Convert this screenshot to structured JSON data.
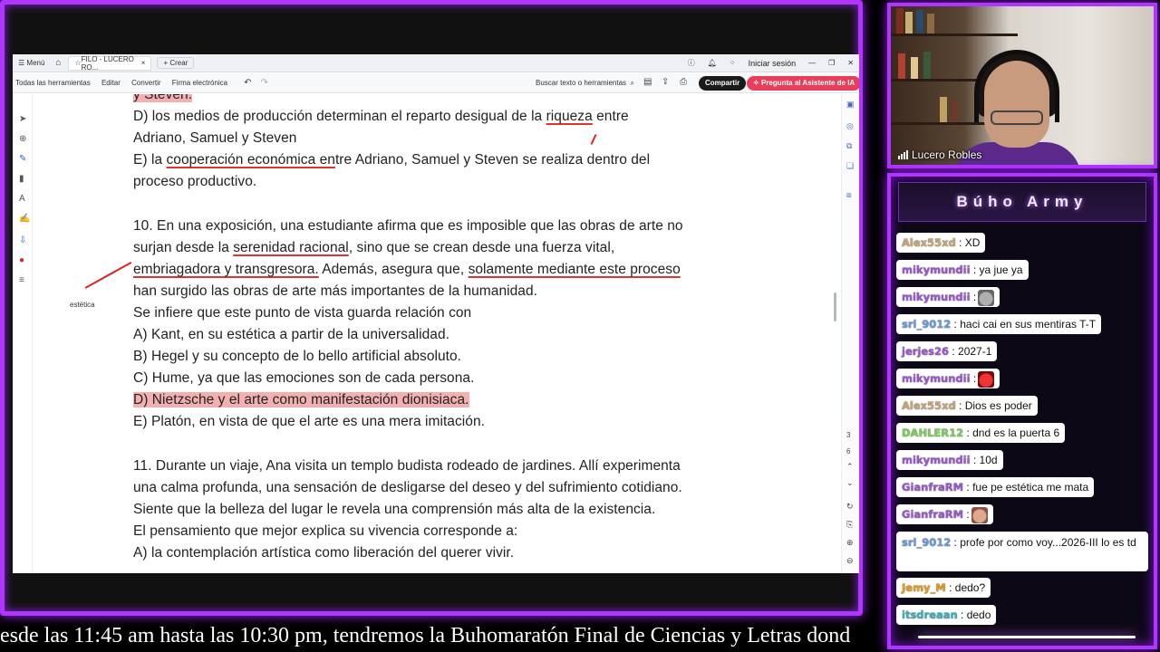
{
  "app": {
    "tabbar": {
      "menu_label": "Menú",
      "tab_title": "FILO - LUCERO RO...",
      "new_tab_label": "+ Crear",
      "sign_in": "Iniciar sesión"
    },
    "toolbar": {
      "items": [
        "Todas las herramientas",
        "Editar",
        "Convertir",
        "Firma electrónica"
      ],
      "search_placeholder": "Buscar texto o herramientas",
      "share_label": "Compartir",
      "ai_label": "Pregunta al Asistente de IA"
    }
  },
  "document": {
    "lines": [
      {
        "text": "y Steven."
      },
      {
        "text": "D) los medios de producción determinan el reparto desigual de la riqueza entre"
      },
      {
        "text": "Adriano, Samuel y Steven"
      },
      {
        "text": "E) la cooperación económica entre Adriano, Samuel y Steven se realiza dentro del"
      },
      {
        "text": "proceso productivo."
      },
      {
        "text": "10. En una exposición, una estudiante afirma que es imposible que las obras de arte no"
      },
      {
        "text": "surjan desde la serenidad racional, sino que se crean desde una fuerza vital,"
      },
      {
        "text": "embriagadora y transgresora. Además, asegura que, solamente mediante este proceso"
      },
      {
        "text": "han surgido las obras de arte más importantes de la humanidad."
      },
      {
        "text": "Se infiere que este punto de vista guarda relación con"
      },
      {
        "text": "A) Kant, en su estética a partir de la universalidad."
      },
      {
        "text": "B) Hegel y su concepto de lo bello artificial absoluto."
      },
      {
        "text": "C) Hume, ya que las emociones son de cada persona."
      },
      {
        "text": "D) Nietzsche y el arte como manifestación dionisiaca."
      },
      {
        "text": "E) Platón, en vista de que el arte es una mera imitación."
      },
      {
        "text": "11. Durante un viaje, Ana visita un templo budista rodeado de jardines. Allí experimenta"
      },
      {
        "text": "una calma profunda, una sensación de desligarse del deseo y del sufrimiento cotidiano."
      },
      {
        "text": "Siente que la belleza del lugar le revela una comprensión más alta de la existencia."
      },
      {
        "text": "El pensamiento que mejor explica su vivencia corresponde a:"
      },
      {
        "text": "A) la contemplación artística como liberación del querer vivir."
      }
    ],
    "margin_note": "estética",
    "page_indicator": "3",
    "page_total": "6"
  },
  "webcam": {
    "name": "Lucero Robles"
  },
  "chat": {
    "title": "Búho Army",
    "messages": [
      {
        "user": "Alex55xd",
        "color": "#c9a77a",
        "text": ": XD",
        "emote": ""
      },
      {
        "user": "mikymundii",
        "color": "#9b59d0",
        "text": ": ya jue ya",
        "emote": ""
      },
      {
        "user": "mikymundii",
        "color": "#9b59d0",
        "text": ":",
        "emote": "cat"
      },
      {
        "user": "srl_9012",
        "color": "#6a9bd8",
        "text": ": haci cai en sus mentiras T-T",
        "emote": ""
      },
      {
        "user": "jerjes26",
        "color": "#9b59d0",
        "text": ": 2027-1",
        "emote": ""
      },
      {
        "user": "mikymundii",
        "color": "#9b59d0",
        "text": ":",
        "emote": "devil"
      },
      {
        "user": "Alex55xd",
        "color": "#c9a77a",
        "text": ": Dios es poder",
        "emote": ""
      },
      {
        "user": "DAHLER12",
        "color": "#7ccf5c",
        "text": ": dnd es la puerta 6",
        "emote": ""
      },
      {
        "user": "mikymundii",
        "color": "#9b59d0",
        "text": ": 10d",
        "emote": ""
      },
      {
        "user": "GianfraRM",
        "color": "#9b59d0",
        "text": ": fue pe estética me mata",
        "emote": ""
      },
      {
        "user": "GianfraRM",
        "color": "#9b59d0",
        "text": ":",
        "emote": "face"
      },
      {
        "user": "srl_9012",
        "color": "#6a9bd8",
        "text": ": profe por como voy...2026-III lo es td",
        "emote": ""
      },
      {
        "user": "Jemy_M",
        "color": "#e0a020",
        "text": ": dedo?",
        "emote": ""
      },
      {
        "user": "itsdreaan",
        "color": "#3fb0c0",
        "text": ": dedo",
        "emote": ""
      }
    ]
  },
  "ticker": {
    "text": "esde las 11:45 am hasta las 10:30 pm, tendremos la Buhomaratón Final de Ciencias y Letras dond"
  },
  "colors": {
    "frame_accent": "#b036ff",
    "highlight_red": "#f3b0b0",
    "underline_red": "#d33",
    "ai_button": "#e83e5a"
  }
}
